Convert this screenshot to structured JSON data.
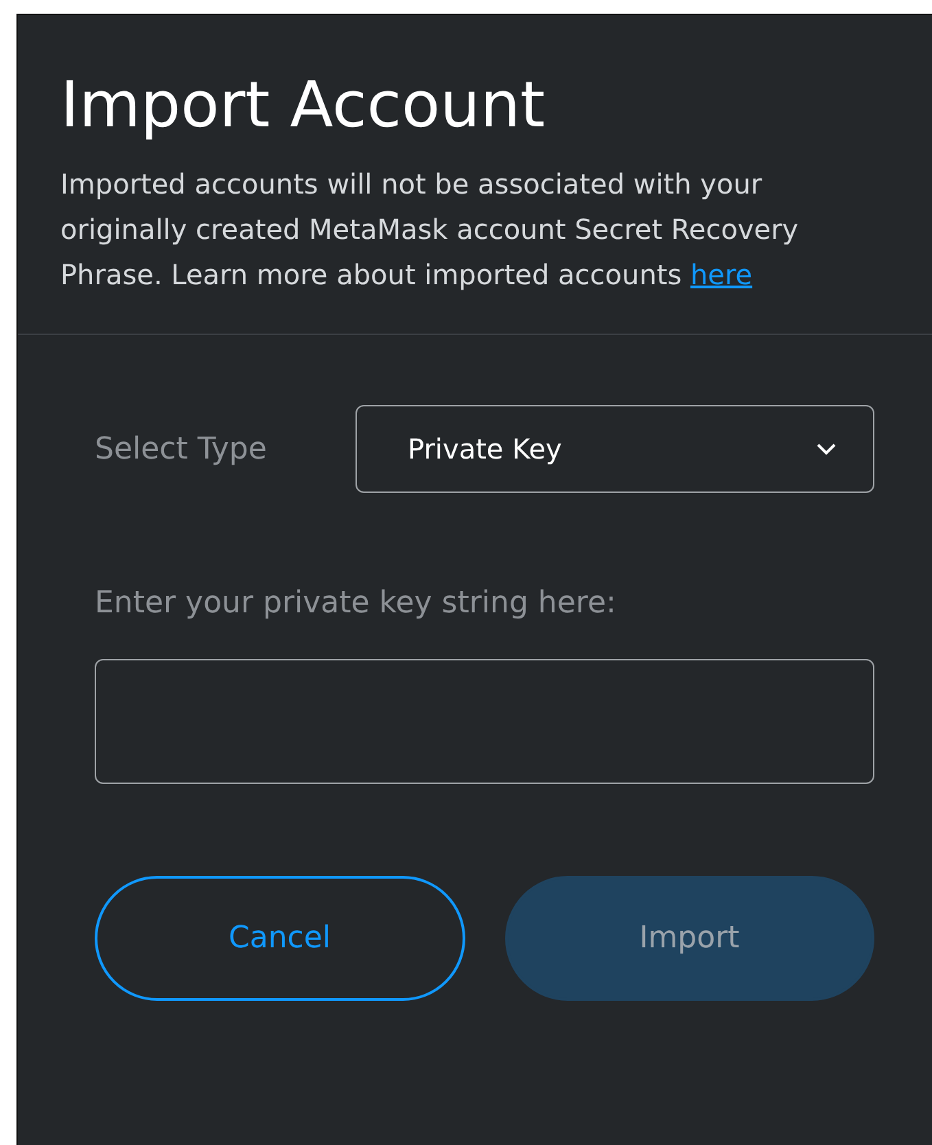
{
  "title": "Import Account",
  "description": {
    "text": "Imported accounts will not be associated with your originally created MetaMask account Secret Recovery Phrase. Learn more about imported accounts",
    "link": "here"
  },
  "select_type": {
    "label": "Select Type",
    "value": "Private Key"
  },
  "private_key": {
    "label": "Enter your private key string here:"
  },
  "buttons": [
    {
      "label": "Cancel",
      "kind": "secondary",
      "disabled": false
    },
    {
      "label": "Import",
      "kind": "primary",
      "disabled": true
    }
  ]
}
